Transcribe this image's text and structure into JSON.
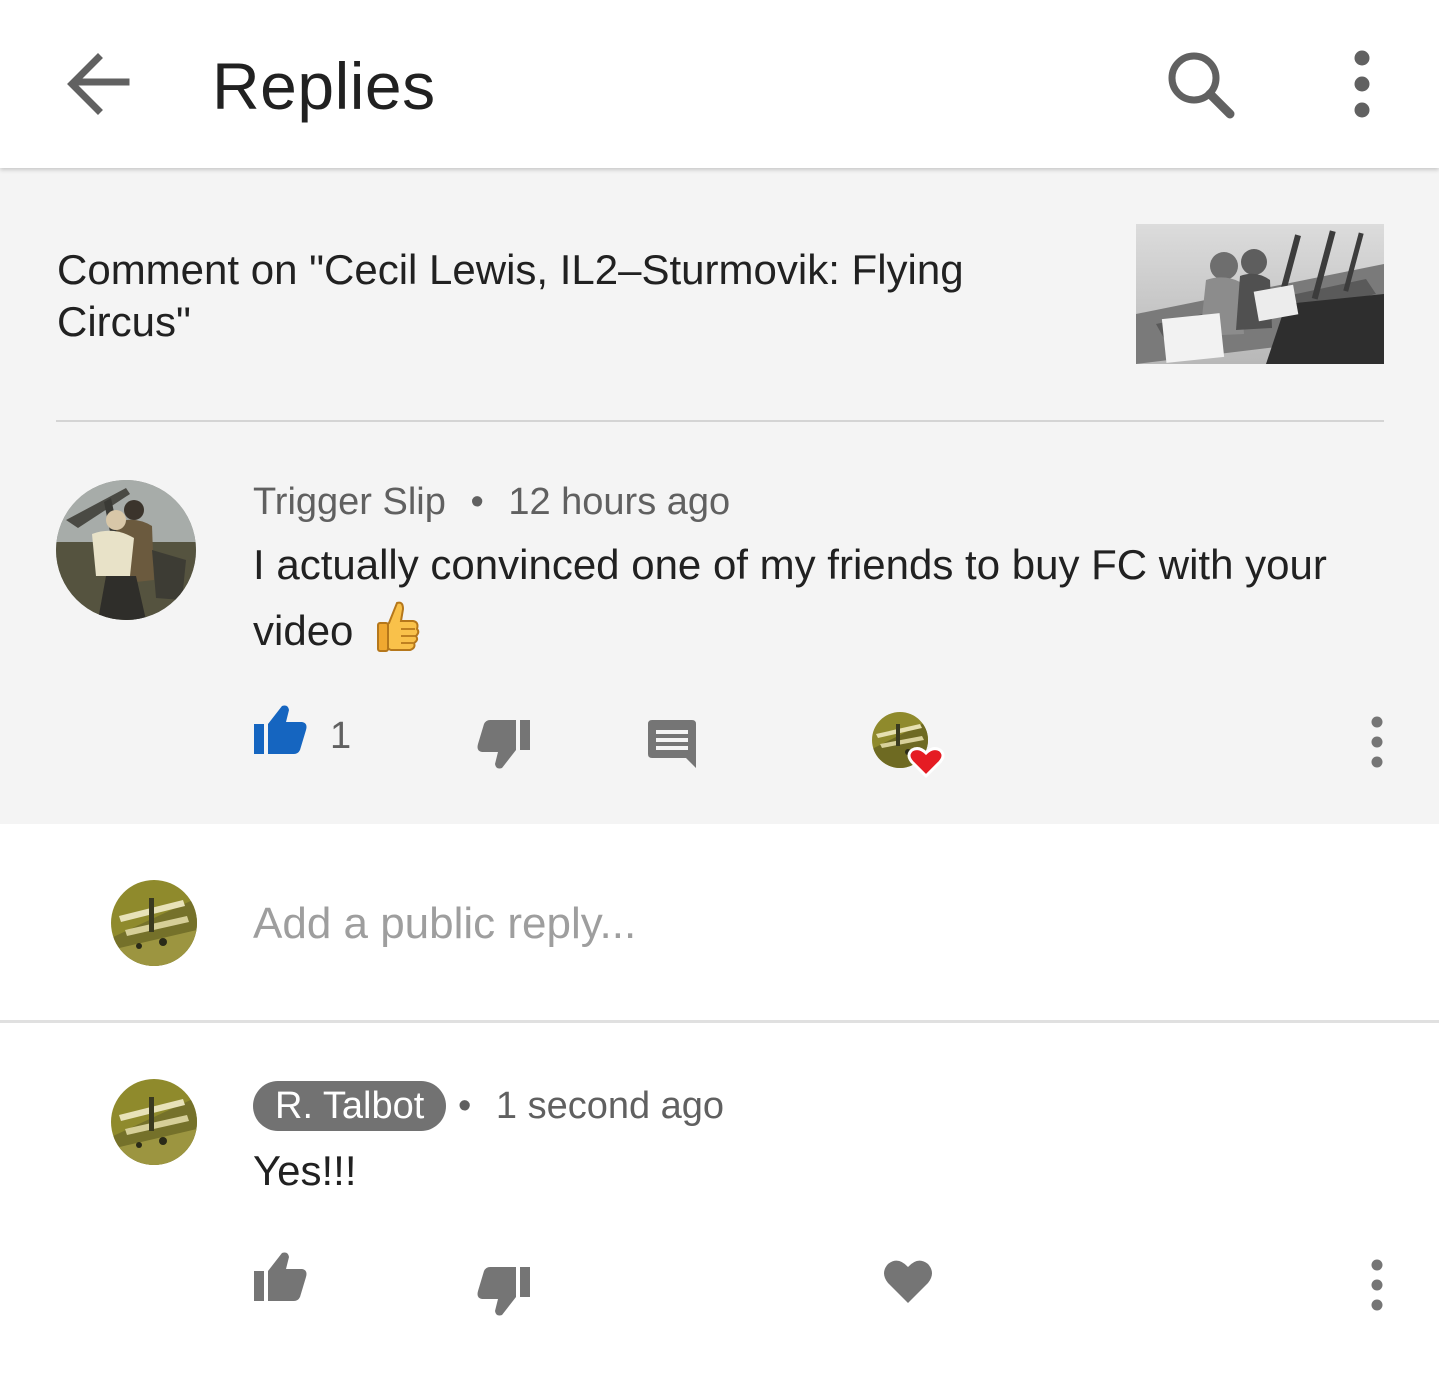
{
  "appbar": {
    "title": "Replies",
    "back_icon": "arrow-back-icon",
    "search_icon": "search-icon",
    "more_icon": "more-vert-icon"
  },
  "parent": {
    "video_context": "Comment on \"Cecil Lewis, IL2–Sturmovik: Flying Circus\"",
    "author": "Trigger Slip",
    "separator": "•",
    "time": "12 hours ago",
    "text": "I actually convinced one of my friends to buy FC with your video",
    "emoji": "thumbs-up-emoji",
    "like_count": "1",
    "liked": true,
    "creator_hearted": true
  },
  "reply_input": {
    "placeholder": "Add a public reply..."
  },
  "reply": {
    "author": "R. Talbot",
    "separator": "•",
    "time": "1 second ago",
    "text": "Yes!!!"
  },
  "colors": {
    "accent_like": "#1565c0",
    "icon_grey": "#757575",
    "heart_red": "#e51c23",
    "badge_bg": "#727272",
    "parent_bg": "#f4f4f4"
  }
}
